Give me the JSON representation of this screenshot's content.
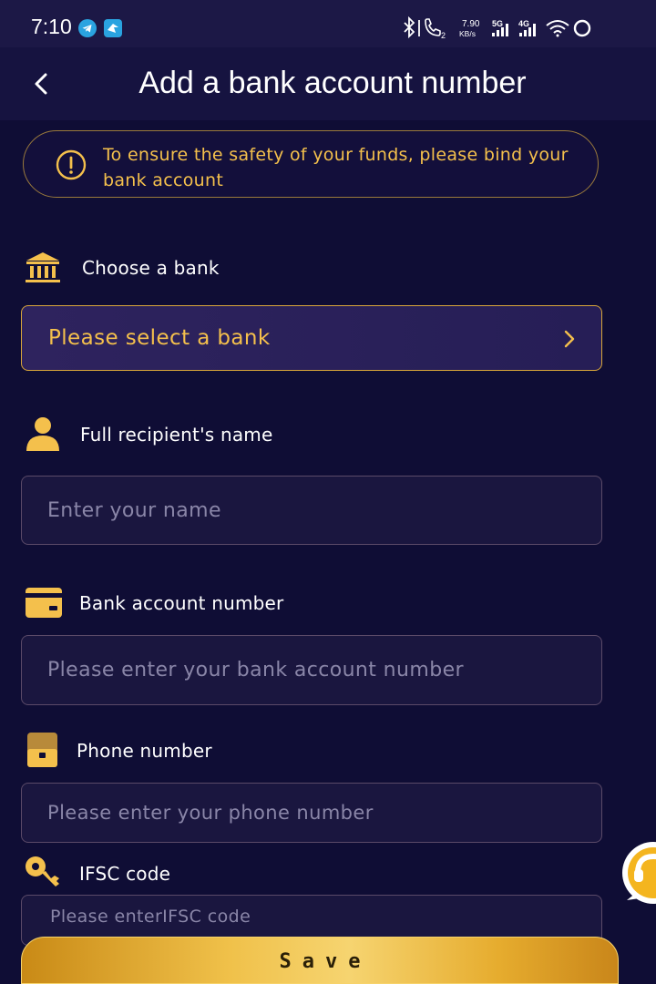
{
  "status_bar": {
    "time": "7:10",
    "speed_value": "7.90",
    "speed_unit": "KB/s",
    "network_1": "5G",
    "network_2": "4G",
    "call_sim": "2"
  },
  "header": {
    "title": "Add a bank account number"
  },
  "notice": {
    "text": "To ensure the safety of your funds, please bind your bank account"
  },
  "form": {
    "bank": {
      "label": "Choose a bank",
      "value": "Please select a bank"
    },
    "name": {
      "label": "Full recipient's name",
      "placeholder": "Enter your name"
    },
    "account": {
      "label": "Bank account number",
      "placeholder": "Please enter your bank account number"
    },
    "phone": {
      "label": "Phone number",
      "placeholder": "Please enter your phone number"
    },
    "ifsc": {
      "label": "IFSC code",
      "placeholder": "Please enterIFSC code"
    }
  },
  "save_button": {
    "label": "Save"
  },
  "colors": {
    "background": "#0f0d35",
    "accent_gold": "#f4c04c",
    "header_bg": "#161340"
  },
  "icons": {
    "bank": "bank-building-icon",
    "name": "person-icon",
    "account": "card-icon",
    "phone": "phone-box-icon",
    "ifsc": "key-icon",
    "notice": "warning-icon",
    "back": "chevron-left-icon",
    "select": "chevron-right-icon",
    "support": "customer-service-icon"
  }
}
